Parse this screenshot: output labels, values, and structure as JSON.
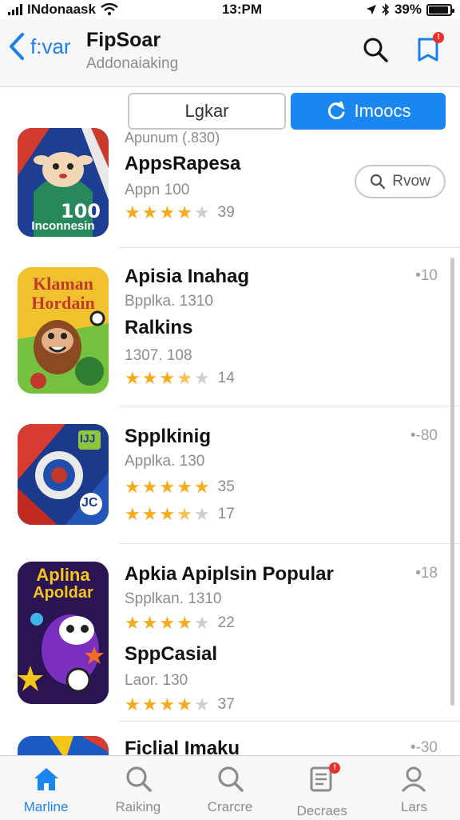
{
  "status_bar": {
    "carrier": "INdonaask",
    "time": "13:PM",
    "battery": "39%"
  },
  "nav": {
    "back_label": "f:var",
    "title": "FipSoar",
    "subtitle": "Addonaiaking"
  },
  "segments": [
    {
      "label": "Lgkar"
    },
    {
      "label": "Imoocs"
    }
  ],
  "apps": [
    {
      "top_caption": "Apunum (.830)",
      "title": "AppsRapesa",
      "sub": "Appn 100",
      "rating": 4,
      "count": "39",
      "button": "Rvow",
      "icon_text": "100",
      "icon_text2": "Inconnesin"
    },
    {
      "title": "Apisia Inahag",
      "sub": "Bpplka. 1310",
      "title2": "Ralkins",
      "sub2": "1307. 108",
      "rating": 3.5,
      "count": "14",
      "metric": "10",
      "icon_text": "Klaman",
      "icon_text2": "Hordain"
    },
    {
      "title": "Spplkinig",
      "sub": "Applka. 130",
      "rating": 5,
      "count": "35",
      "rating2": 3.5,
      "count2": "17",
      "metric": "80",
      "icon_text": "IJJ",
      "icon_text2": "JC"
    },
    {
      "title": "Apkia Apiplsin Popular",
      "sub": "Spplkan. 1310",
      "rating": 4,
      "count": "22",
      "title2": "SppCasial",
      "sub2": "Laor. 130",
      "rating2": 4,
      "count2": "37",
      "metric": "18",
      "icon_text": "Aplina",
      "icon_text2": "Apoldar"
    },
    {
      "title": "Ficlial Imaku",
      "metric": "30"
    }
  ],
  "tabs": [
    {
      "label": "Marline"
    },
    {
      "label": "Raiking"
    },
    {
      "label": "Crarcre"
    },
    {
      "label": "Decraes"
    },
    {
      "label": "Lars"
    }
  ],
  "colors": {
    "accent": "#1a86ef",
    "star": "#f5ab1c",
    "badge": "#e8312c"
  }
}
